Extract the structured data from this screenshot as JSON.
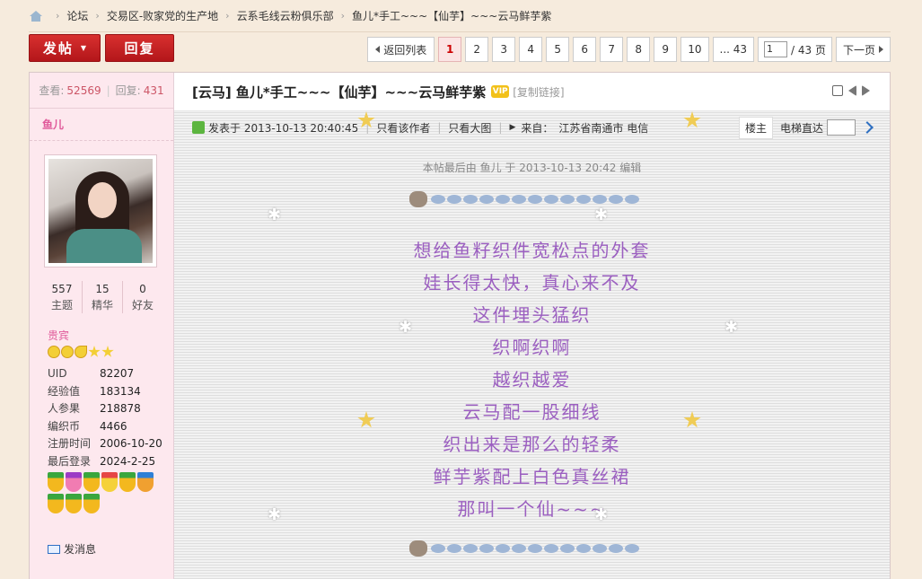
{
  "breadcrumb": [
    "论坛",
    "交易区-败家党的生产地",
    "云系毛线云粉俱乐部",
    "鱼儿*手工~~~【仙芋】~~~云马鲜芋紫"
  ],
  "toolbar": {
    "post_label": "发帖",
    "reply_label": "回复"
  },
  "pager": {
    "back": "返回列表",
    "pages": [
      "1",
      "2",
      "3",
      "4",
      "5",
      "6",
      "7",
      "8",
      "9",
      "10",
      "... 43"
    ],
    "current": "1",
    "total": "/ 43 页",
    "next": "下一页"
  },
  "stats": {
    "views_label": "查看:",
    "views": "52569",
    "replies_label": "回复:",
    "replies": "431"
  },
  "user": {
    "name": "鱼儿",
    "counts": [
      {
        "num": "557",
        "label": "主题"
      },
      {
        "num": "15",
        "label": "精华"
      },
      {
        "num": "0",
        "label": "好友"
      }
    ],
    "group": "贵宾",
    "info": [
      {
        "k": "UID",
        "v": "82207"
      },
      {
        "k": "经验值",
        "v": "183134"
      },
      {
        "k": "人参果",
        "v": "218878"
      },
      {
        "k": "编织币",
        "v": "4466"
      },
      {
        "k": "注册时间",
        "v": "2006-10-20"
      },
      {
        "k": "最后登录",
        "v": "2024-2-25"
      }
    ],
    "message": "发消息"
  },
  "post": {
    "title": "[云马] 鱼儿*手工~~~【仙芋】~~~云马鲜芋紫",
    "vip": "VIP",
    "copy": "[复制链接]",
    "posted": "发表于 2013-10-13 20:40:45",
    "author_only": "只看该作者",
    "large_img": "只看大图",
    "from_label": "来自：",
    "from": "江苏省南通市 电信",
    "floor": "楼主",
    "lift": "电梯直达",
    "edited": "本帖最后由 鱼儿 于 2013-10-13 20:42 编辑",
    "lines": [
      "想给鱼籽织件宽松点的外套",
      "娃长得太快，真心来不及",
      "这件埋头猛织",
      "织啊织啊",
      "越织越爱",
      "云马配一股细线",
      "织出来是那么的轻柔",
      "鲜芋紫配上白色真丝裙",
      "那叫一个仙~~~"
    ]
  }
}
